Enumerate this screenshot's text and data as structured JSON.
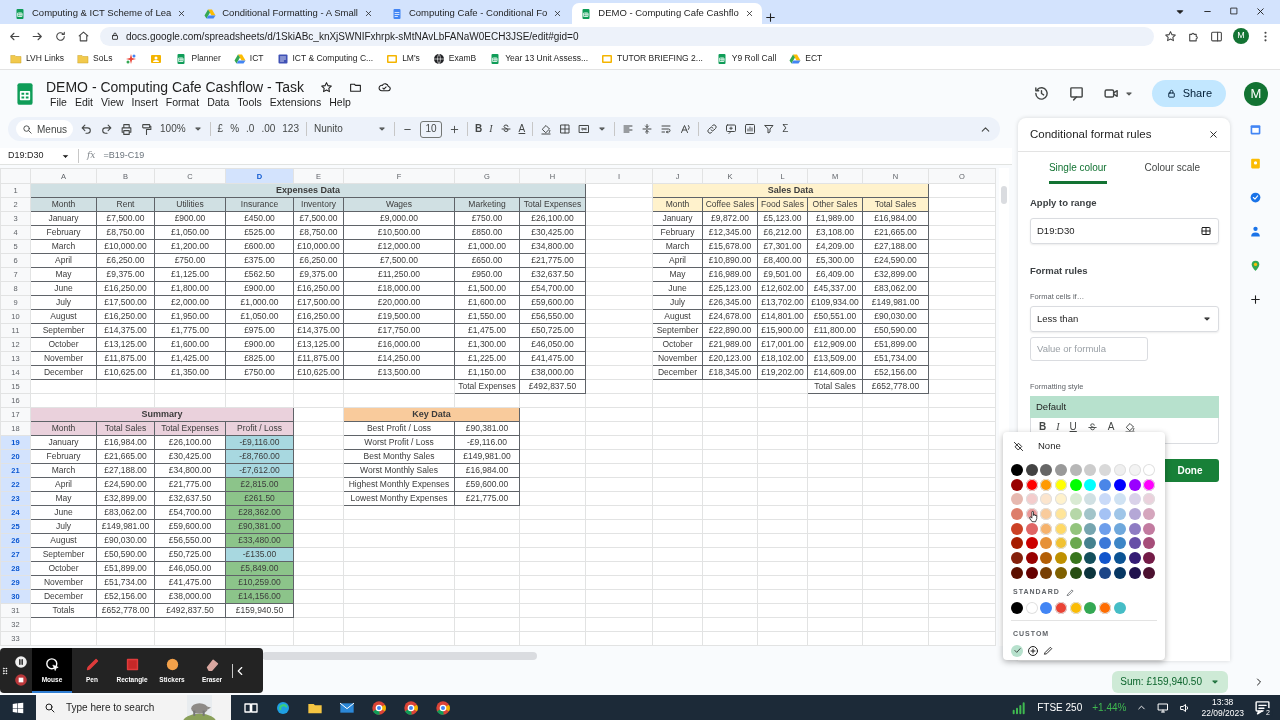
{
  "browser": {
    "tabs": [
      {
        "title": "Computing & ICT Scheme of Lea",
        "kind": "sheets",
        "selected": false
      },
      {
        "title": "Conditional Formatting - A Small",
        "kind": "drive",
        "selected": false
      },
      {
        "title": "Computing Cafe - Conditional Fo",
        "kind": "docs",
        "selected": false
      },
      {
        "title": "DEMO - Computing Cafe Cashflo",
        "kind": "sheets",
        "selected": true
      }
    ],
    "url": "docs.google.com/spreadsheets/d/1SkiABc_knXjSWNIFxhrpk-sMtNAvLbFANaW0ECH3JSE/edit#gid=0",
    "profile": "M",
    "bookmarks": [
      {
        "label": "LVH Links",
        "kind": "folder"
      },
      {
        "label": "SoLs",
        "kind": "folder"
      },
      {
        "kind": "sparkle"
      },
      {
        "kind": "contact"
      },
      {
        "label": "Planner",
        "kind": "sheets"
      },
      {
        "label": "ICT",
        "kind": "drive"
      },
      {
        "label": "ICT & Computing C...",
        "kind": "form"
      },
      {
        "label": "LM's",
        "kind": "slides"
      },
      {
        "label": "ExamB",
        "kind": "globe"
      },
      {
        "label": "Year 13 Unit Assess...",
        "kind": "sheets"
      },
      {
        "label": "TUTOR BRIEFING 2...",
        "kind": "slides"
      },
      {
        "label": "Y9 Roll Call",
        "kind": "sheets"
      },
      {
        "label": "ECT",
        "kind": "drive"
      }
    ]
  },
  "document": {
    "title": "DEMO - Computing Cafe Cashflow - Task",
    "menus": [
      "File",
      "Edit",
      "View",
      "Insert",
      "Format",
      "Data",
      "Tools",
      "Extensions",
      "Help"
    ],
    "share": "Share",
    "avatar": "M"
  },
  "toolbar": {
    "search_label": "Menus",
    "zoom": "100%",
    "currency": "£",
    "percent": "%",
    "decrease_decimals": ".0",
    "increase_decimals": ".00",
    "number_format": "123",
    "font": "Nunito",
    "font_size": "10",
    "bold": "B",
    "italic": "I",
    "text_color": "A",
    "functions": "Σ"
  },
  "sheet": {
    "name_box": "D19:D30",
    "function_label": "fx",
    "formula": "=B19-C19",
    "column_headers": [
      {
        "label": "A",
        "selected": false
      },
      {
        "label": "B",
        "selected": false
      },
      {
        "label": "C",
        "selected": false
      },
      {
        "label": "D",
        "selected": true
      },
      {
        "label": "E",
        "selected": false
      },
      {
        "label": "F",
        "selected": false
      },
      {
        "label": "G",
        "selected": false
      },
      {
        "label": "H",
        "selected": false
      },
      {
        "label": "I",
        "selected": false
      },
      {
        "label": "J",
        "selected": false
      },
      {
        "label": "K",
        "selected": false
      },
      {
        "label": "L",
        "selected": false
      },
      {
        "label": "M",
        "selected": false
      },
      {
        "label": "N",
        "selected": false
      },
      {
        "label": "O",
        "selected": false
      }
    ],
    "row_headers": [
      {
        "label": "1",
        "selected": false
      },
      {
        "label": "2",
        "selected": false
      },
      {
        "label": "3",
        "selected": false
      },
      {
        "label": "4",
        "selected": false
      },
      {
        "label": "5",
        "selected": false
      },
      {
        "label": "6",
        "selected": false
      },
      {
        "label": "7",
        "selected": false
      },
      {
        "label": "8",
        "selected": false
      },
      {
        "label": "9",
        "selected": false
      },
      {
        "label": "10",
        "selected": false
      },
      {
        "label": "11",
        "selected": false
      },
      {
        "label": "12",
        "selected": false
      },
      {
        "label": "13",
        "selected": false
      },
      {
        "label": "14",
        "selected": false
      },
      {
        "label": "15",
        "selected": false
      },
      {
        "label": "16",
        "selected": false
      },
      {
        "label": "17",
        "selected": false
      },
      {
        "label": "18",
        "selected": false
      },
      {
        "label": "19",
        "selected": true
      },
      {
        "label": "20",
        "selected": true
      },
      {
        "label": "21",
        "selected": true
      },
      {
        "label": "22",
        "selected": true
      },
      {
        "label": "23",
        "selected": true
      },
      {
        "label": "24",
        "selected": true
      },
      {
        "label": "25",
        "selected": true
      },
      {
        "label": "26",
        "selected": true
      },
      {
        "label": "27",
        "selected": true
      },
      {
        "label": "28",
        "selected": true
      },
      {
        "label": "29",
        "selected": true
      },
      {
        "label": "30",
        "selected": true
      },
      {
        "label": "31",
        "selected": false
      },
      {
        "label": "32",
        "selected": false
      },
      {
        "label": "33",
        "selected": false
      }
    ],
    "expenses": {
      "title": "Expenses Data",
      "columns": [
        "Month",
        "Rent",
        "Utilities",
        "Insurance",
        "Inventory",
        "Wages",
        "Marketing",
        "Total Expenses"
      ],
      "rows": [
        [
          "January",
          "£7,500.00",
          "£900.00",
          "£450.00",
          "£7,500.00",
          "£9,000.00",
          "£750.00",
          "£26,100.00"
        ],
        [
          "February",
          "£8,750.00",
          "£1,050.00",
          "£525.00",
          "£8,750.00",
          "£10,500.00",
          "£850.00",
          "£30,425.00"
        ],
        [
          "March",
          "£10,000.00",
          "£1,200.00",
          "£600.00",
          "£10,000.00",
          "£12,000.00",
          "£1,000.00",
          "£34,800.00"
        ],
        [
          "April",
          "£6,250.00",
          "£750.00",
          "£375.00",
          "£6,250.00",
          "£7,500.00",
          "£650.00",
          "£21,775.00"
        ],
        [
          "May",
          "£9,375.00",
          "£1,125.00",
          "£562.50",
          "£9,375.00",
          "£11,250.00",
          "£950.00",
          "£32,637.50"
        ],
        [
          "June",
          "£16,250.00",
          "£1,800.00",
          "£900.00",
          "£16,250.00",
          "£18,000.00",
          "£1,500.00",
          "£54,700.00"
        ],
        [
          "July",
          "£17,500.00",
          "£2,000.00",
          "£1,000.00",
          "£17,500.00",
          "£20,000.00",
          "£1,600.00",
          "£59,600.00"
        ],
        [
          "August",
          "£16,250.00",
          "£1,950.00",
          "£1,050.00",
          "£16,250.00",
          "£19,500.00",
          "£1,550.00",
          "£56,550.00"
        ],
        [
          "September",
          "£14,375.00",
          "£1,775.00",
          "£975.00",
          "£14,375.00",
          "£17,750.00",
          "£1,475.00",
          "£50,725.00"
        ],
        [
          "October",
          "£13,125.00",
          "£1,600.00",
          "£900.00",
          "£13,125.00",
          "£16,000.00",
          "£1,300.00",
          "£46,050.00"
        ],
        [
          "November",
          "£11,875.00",
          "£1,425.00",
          "£825.00",
          "£11,875.00",
          "£14,250.00",
          "£1,225.00",
          "£41,475.00"
        ],
        [
          "December",
          "£10,625.00",
          "£1,350.00",
          "£750.00",
          "£10,625.00",
          "£13,500.00",
          "£1,150.00",
          "£38,000.00"
        ]
      ],
      "footer": {
        "label": "Total Expenses",
        "value": "£492,837.50"
      }
    },
    "sales": {
      "title": "Sales Data",
      "columns": [
        "Month",
        "Coffee Sales",
        "Food Sales",
        "Other Sales",
        "Total Sales"
      ],
      "rows": [
        [
          "January",
          "£9,872.00",
          "£5,123.00",
          "£1,989.00",
          "£16,984.00"
        ],
        [
          "February",
          "£12,345.00",
          "£6,212.00",
          "£3,108.00",
          "£21,665.00"
        ],
        [
          "March",
          "£15,678.00",
          "£7,301.00",
          "£4,209.00",
          "£27,188.00"
        ],
        [
          "April",
          "£10,890.00",
          "£8,400.00",
          "£5,300.00",
          "£24,590.00"
        ],
        [
          "May",
          "£16,989.00",
          "£9,501.00",
          "£6,409.00",
          "£32,899.00"
        ],
        [
          "June",
          "£25,123.00",
          "£12,602.00",
          "£45,337.00",
          "£83,062.00"
        ],
        [
          "July",
          "£26,345.00",
          "£13,702.00",
          "£109,934.00",
          "£149,981.00"
        ],
        [
          "August",
          "£24,678.00",
          "£14,801.00",
          "£50,551.00",
          "£90,030.00"
        ],
        [
          "September",
          "£22,890.00",
          "£15,900.00",
          "£11,800.00",
          "£50,590.00"
        ],
        [
          "October",
          "£21,989.00",
          "£17,001.00",
          "£12,909.00",
          "£51,899.00"
        ],
        [
          "November",
          "£20,123.00",
          "£18,102.00",
          "£13,509.00",
          "£51,734.00"
        ],
        [
          "December",
          "£18,345.00",
          "£19,202.00",
          "£14,609.00",
          "£52,156.00"
        ]
      ],
      "footer": {
        "label": "Total Sales",
        "value": "£652,778.00"
      }
    },
    "summary": {
      "title": "Summary",
      "columns": [
        "Month",
        "Total Sales",
        "Total Expenses",
        "Profit / Loss"
      ],
      "rows": [
        {
          "cells": [
            "January",
            "£16,984.00",
            "£26,100.00",
            "-£9,116.00"
          ],
          "color": "#a8d8e0"
        },
        {
          "cells": [
            "February",
            "£21,665.00",
            "£30,425.00",
            "-£8,760.00"
          ],
          "color": "#a8d8e0"
        },
        {
          "cells": [
            "March",
            "£27,188.00",
            "£34,800.00",
            "-£7,612.00"
          ],
          "color": "#a8d8e0"
        },
        {
          "cells": [
            "April",
            "£24,590.00",
            "£21,775.00",
            "£2,815.00"
          ],
          "color": "#8cc48a"
        },
        {
          "cells": [
            "May",
            "£32,899.00",
            "£32,637.50",
            "£261.50"
          ],
          "color": "#8cc48a"
        },
        {
          "cells": [
            "June",
            "£83,062.00",
            "£54,700.00",
            "£28,362.00"
          ],
          "color": "#8cc48a"
        },
        {
          "cells": [
            "July",
            "£149,981.00",
            "£59,600.00",
            "£90,381.00"
          ],
          "color": "#8cc48a"
        },
        {
          "cells": [
            "August",
            "£90,030.00",
            "£56,550.00",
            "£33,480.00"
          ],
          "color": "#8cc48a"
        },
        {
          "cells": [
            "September",
            "£50,590.00",
            "£50,725.00",
            "-£135.00"
          ],
          "color": "#a8d8e0"
        },
        {
          "cells": [
            "October",
            "£51,899.00",
            "£46,050.00",
            "£5,849.00"
          ],
          "color": "#8cc48a"
        },
        {
          "cells": [
            "November",
            "£51,734.00",
            "£41,475.00",
            "£10,259.00"
          ],
          "color": "#8cc48a"
        },
        {
          "cells": [
            "December",
            "£52,156.00",
            "£38,000.00",
            "£14,156.00"
          ],
          "color": "#8cc48a"
        }
      ],
      "totals": [
        "Totals",
        "£652,778.00",
        "£492,837.50",
        "£159,940.50"
      ]
    },
    "key_data": {
      "title": "Key Data",
      "rows": [
        [
          "Best Profit / Loss",
          "£90,381.00"
        ],
        [
          "Worst Profit / Loss",
          "-£9,116.00"
        ],
        [
          "Best Monthy Sales",
          "£149,981.00"
        ],
        [
          "Worst Monthly Sales",
          "£16,984.00"
        ],
        [
          "Highest Monthly Expenses",
          "£59,600.00"
        ],
        [
          "Lowest Monthy Expenses",
          "£21,775.00"
        ]
      ]
    }
  },
  "panel": {
    "title": "Conditional format rules",
    "tabs": [
      {
        "label": "Single colour",
        "selected": true
      },
      {
        "label": "Colour scale",
        "selected": false
      }
    ],
    "apply_label": "Apply to range",
    "range": "D19:D30",
    "rules_label": "Format rules",
    "condition_label": "Format cells if…",
    "condition": "Less than",
    "value_placeholder": "Value or formula",
    "style_label": "Formatting style",
    "preview": "Default",
    "style_toolbar": {
      "bold": "B",
      "italic": "I",
      "underline": "U",
      "text_color": "A"
    },
    "done": "Done"
  },
  "palette": {
    "none_label": "None",
    "rows": [
      {
        "swatches": [
          {
            "color": "#000000"
          },
          {
            "color": "#434343"
          },
          {
            "color": "#666666"
          },
          {
            "color": "#999999"
          },
          {
            "color": "#b7b7b7"
          },
          {
            "color": "#cccccc"
          },
          {
            "color": "#d9d9d9"
          },
          {
            "color": "#efefef"
          },
          {
            "color": "#f3f3f3"
          },
          {
            "color": "#ffffff"
          }
        ]
      },
      {
        "swatches": [
          {
            "color": "#980000"
          },
          {
            "color": "#ff0000"
          },
          {
            "color": "#ff9900"
          },
          {
            "color": "#ffff00"
          },
          {
            "color": "#00ff00"
          },
          {
            "color": "#00ffff"
          },
          {
            "color": "#4a86e8"
          },
          {
            "color": "#0000ff"
          },
          {
            "color": "#9900ff"
          },
          {
            "color": "#ff00ff"
          }
        ]
      },
      {
        "swatches": [
          {
            "color": "#e6b8af"
          },
          {
            "color": "#f4cccc"
          },
          {
            "color": "#fce5cd"
          },
          {
            "color": "#fff2cc"
          },
          {
            "color": "#d9ead3"
          },
          {
            "color": "#d0e0e3"
          },
          {
            "color": "#c9daf8"
          },
          {
            "color": "#cfe2f3"
          },
          {
            "color": "#d9d2e9"
          },
          {
            "color": "#ead1dc"
          }
        ]
      },
      {
        "swatches": [
          {
            "color": "#dd7e6b"
          },
          {
            "color": "#ea9999"
          },
          {
            "color": "#f9cb9c"
          },
          {
            "color": "#ffe599"
          },
          {
            "color": "#b6d7a8"
          },
          {
            "color": "#a2c4c9"
          },
          {
            "color": "#a4c2f4"
          },
          {
            "color": "#9fc5e8"
          },
          {
            "color": "#b4a7d6"
          },
          {
            "color": "#d5a6bd"
          }
        ]
      },
      {
        "swatches": [
          {
            "color": "#cc4125"
          },
          {
            "color": "#e06666"
          },
          {
            "color": "#f6b26b"
          },
          {
            "color": "#ffd966"
          },
          {
            "color": "#93c47d"
          },
          {
            "color": "#76a5af"
          },
          {
            "color": "#6d9eeb"
          },
          {
            "color": "#6fa8dc"
          },
          {
            "color": "#8e7cc3"
          },
          {
            "color": "#c27ba0"
          }
        ]
      },
      {
        "swatches": [
          {
            "color": "#a61c00"
          },
          {
            "color": "#cc0000"
          },
          {
            "color": "#e69138"
          },
          {
            "color": "#f1c232"
          },
          {
            "color": "#6aa84f"
          },
          {
            "color": "#45818e"
          },
          {
            "color": "#3c78d8"
          },
          {
            "color": "#3d85c6"
          },
          {
            "color": "#674ea7"
          },
          {
            "color": "#a64d79"
          }
        ]
      },
      {
        "swatches": [
          {
            "color": "#85200c"
          },
          {
            "color": "#990000"
          },
          {
            "color": "#b45f06"
          },
          {
            "color": "#bf9000"
          },
          {
            "color": "#38761d"
          },
          {
            "color": "#134f5c"
          },
          {
            "color": "#1155cc"
          },
          {
            "color": "#0b5394"
          },
          {
            "color": "#351c75"
          },
          {
            "color": "#741b47"
          }
        ]
      },
      {
        "swatches": [
          {
            "color": "#5b0f00"
          },
          {
            "color": "#660000"
          },
          {
            "color": "#783f04"
          },
          {
            "color": "#7f6000"
          },
          {
            "color": "#274e13"
          },
          {
            "color": "#0c343d"
          },
          {
            "color": "#1c4587"
          },
          {
            "color": "#073763"
          },
          {
            "color": "#20124d"
          },
          {
            "color": "#4c1130"
          }
        ]
      }
    ],
    "standard_label": "STANDARD",
    "standard": [
      {
        "color": "#000000"
      },
      {
        "color": "#ffffff"
      },
      {
        "color": "#4285f4"
      },
      {
        "color": "#ea4335"
      },
      {
        "color": "#fbbc04"
      },
      {
        "color": "#34a853"
      },
      {
        "color": "#ff6d01"
      },
      {
        "color": "#46bdc6"
      }
    ],
    "custom_label": "CUSTOM",
    "custom": [
      {
        "color": "#b7e1cd",
        "checked": true
      }
    ]
  },
  "status": {
    "sum": "Sum: £159,940.50"
  },
  "recorder": {
    "tools": [
      {
        "label": "Mouse",
        "kind": "mouse",
        "selected": true
      },
      {
        "label": "Pen",
        "kind": "pen",
        "selected": false
      },
      {
        "label": "Rectangle",
        "kind": "rectangle",
        "selected": false
      },
      {
        "label": "Stickers",
        "kind": "stickers",
        "selected": false
      },
      {
        "label": "Eraser",
        "kind": "eraser",
        "selected": false
      }
    ]
  },
  "taskbar": {
    "search_placeholder": "Type here to search",
    "ticker": "FTSE 250",
    "change": "+1.44%",
    "time": "13:38",
    "date": "22/09/2023",
    "notifications": "2"
  }
}
